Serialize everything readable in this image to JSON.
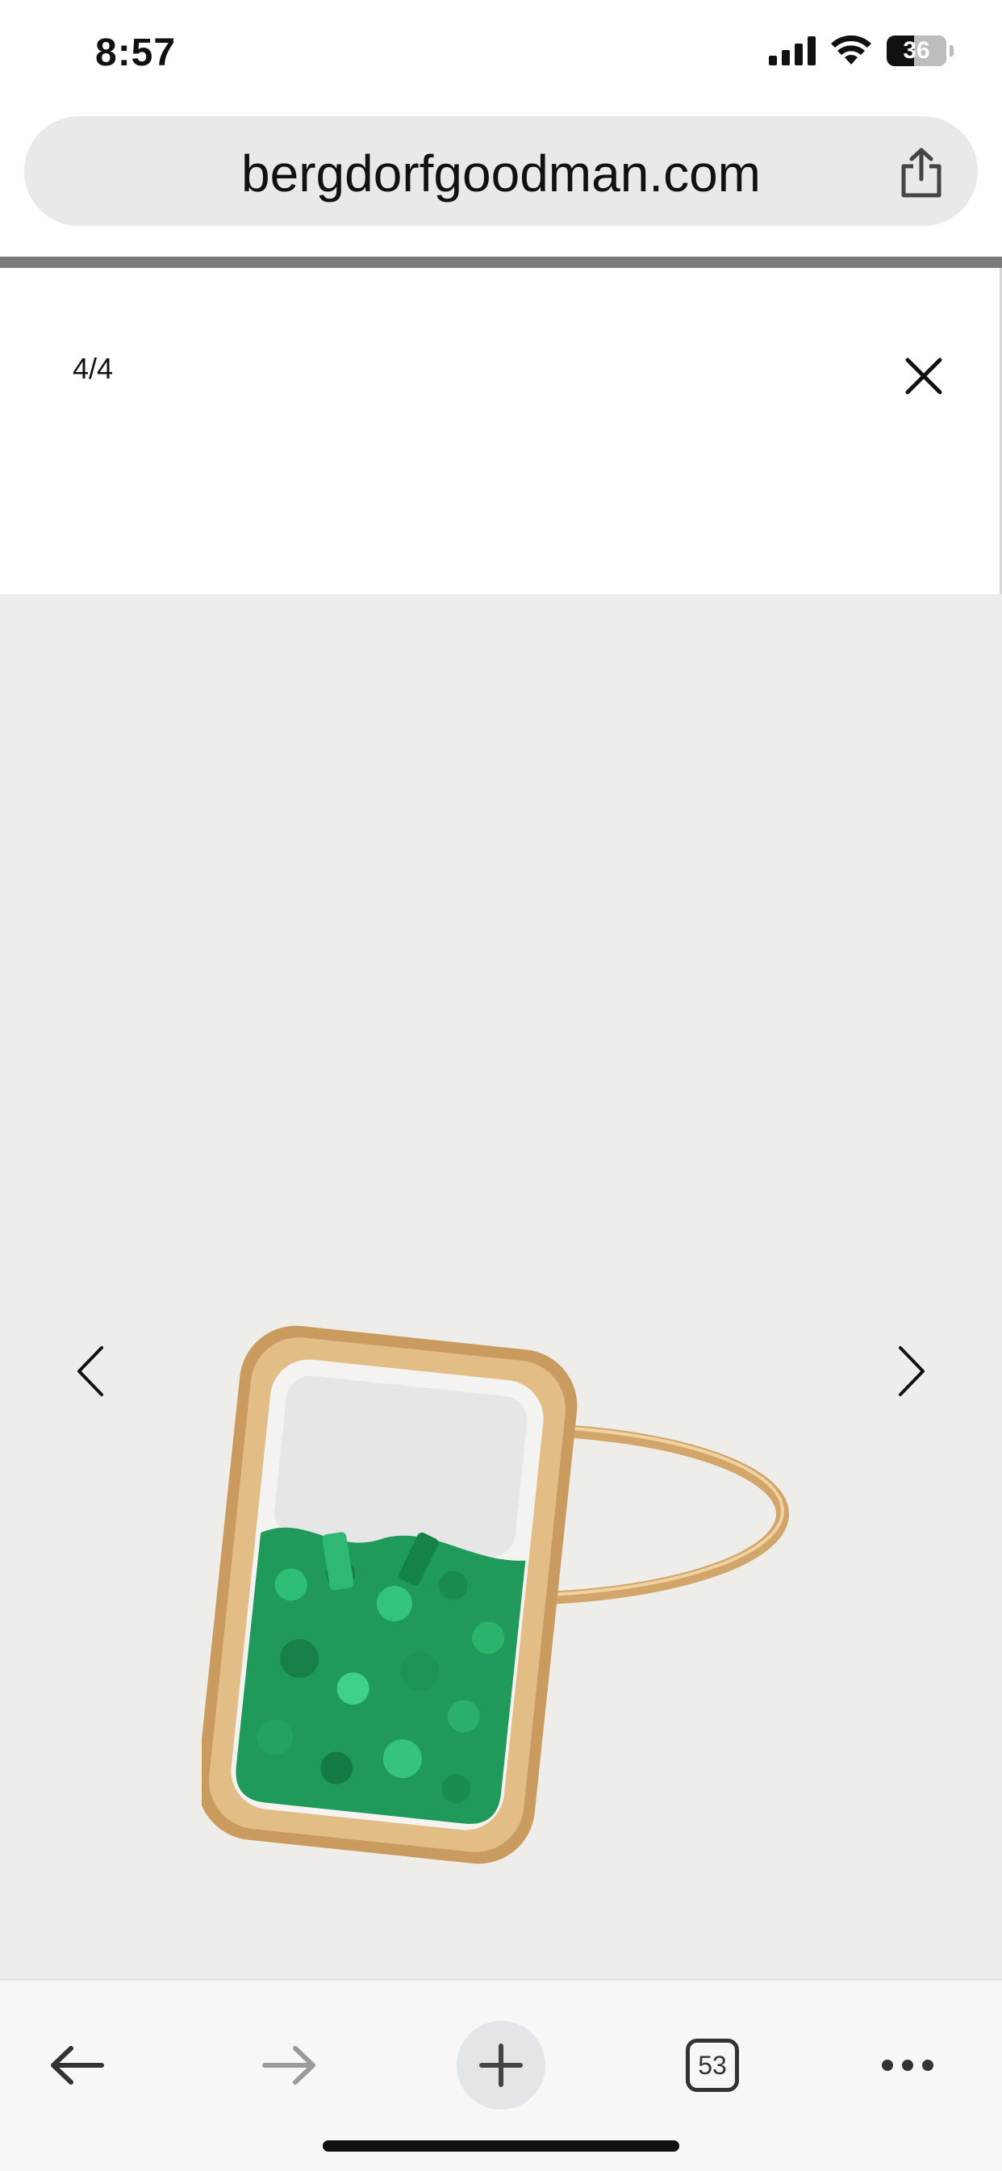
{
  "status_bar": {
    "time": "8:57",
    "battery": "36"
  },
  "browser": {
    "url": "bergdorfgoodman.com",
    "tabs_count": "53"
  },
  "viewer": {
    "counter": "4/4"
  },
  "icons": {
    "signal": "cellular-signal-icon",
    "wifi": "wifi-icon",
    "battery": "battery-icon",
    "share": "share-icon",
    "close": "close-icon",
    "prev": "chevron-left-icon",
    "next": "chevron-right-icon",
    "back": "back-arrow-icon",
    "forward": "forward-arrow-icon",
    "new_tab": "plus-icon",
    "tabs": "tabs-icon",
    "more": "more-icon"
  },
  "colors": {
    "image_background": "#efede9",
    "gold": "#d2a56b",
    "emerald": "#1f9a5a"
  }
}
